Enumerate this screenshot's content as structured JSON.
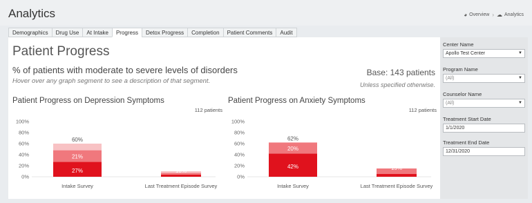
{
  "header": {
    "title": "Analytics",
    "breadcrumbs": [
      {
        "icon": "speedometer-icon",
        "label": "Overview"
      },
      {
        "icon": "cloud-icon",
        "label": "Analytics"
      }
    ]
  },
  "tabs": [
    {
      "label": "Demographics",
      "active": false
    },
    {
      "label": "Drug Use",
      "active": false
    },
    {
      "label": "At Intake",
      "active": false
    },
    {
      "label": "Progress",
      "active": true
    },
    {
      "label": "Detox Progress",
      "active": false
    },
    {
      "label": "Completion",
      "active": false
    },
    {
      "label": "Patient Comments",
      "active": false
    },
    {
      "label": "Audit",
      "active": false
    }
  ],
  "main": {
    "title": "Patient Progress",
    "subtitle": "% of patients with moderate to severe levels of disorders",
    "hint": "Hover over any graph segment to see a description of that segment.",
    "base": "Base: 143 patients",
    "base_note": "Unless specified otherwise."
  },
  "chart_data": [
    {
      "type": "bar",
      "title": "Patient Progress on Depression Symptoms",
      "count_label": "112 patients",
      "categories": [
        "Intake Survey",
        "Last Treatment Episode Survey"
      ],
      "yticks": [
        "100%",
        "80%",
        "60%",
        "40%",
        "20%",
        "0%"
      ],
      "ylim": [
        0,
        100
      ],
      "totals": [
        60,
        10
      ],
      "series": [
        {
          "values": [
            27,
            4
          ],
          "color": "#e0121d"
        },
        {
          "values": [
            21,
            3
          ],
          "color": "#f0787d"
        },
        {
          "values": [
            12,
            3
          ],
          "color": "#f8c2c4"
        }
      ],
      "labels": [
        {
          "cat": 0,
          "text": "60%",
          "y": 60
        },
        {
          "cat": 0,
          "text": "21%",
          "y": 37
        },
        {
          "cat": 0,
          "text": "27%",
          "y": 11
        },
        {
          "cat": 1,
          "text": "10%",
          "y": 11
        }
      ]
    },
    {
      "type": "bar",
      "title": "Patient Progress on Anxiety Symptoms",
      "count_label": "112 patients",
      "categories": [
        "Intake Survey",
        "Last Treatment Episode Survey"
      ],
      "yticks": [
        "100%",
        "80%",
        "60%",
        "40%",
        "20%",
        "0%"
      ],
      "ylim": [
        0,
        100
      ],
      "totals": [
        62,
        15
      ],
      "series": [
        {
          "values": [
            42,
            5
          ],
          "color": "#e0121d"
        },
        {
          "values": [
            20,
            10
          ],
          "color": "#f0787d"
        }
      ],
      "labels": [
        {
          "cat": 0,
          "text": "62%",
          "y": 62
        },
        {
          "cat": 0,
          "text": "20%",
          "y": 51
        },
        {
          "cat": 0,
          "text": "42%",
          "y": 19
        },
        {
          "cat": 1,
          "text": "15%",
          "y": 16
        }
      ]
    }
  ],
  "filters": {
    "center": {
      "label": "Center Name",
      "value": "Apollo Test Center"
    },
    "program": {
      "label": "Program Name",
      "value": "(All)"
    },
    "counselor": {
      "label": "Counselor Name",
      "value": "(All)"
    },
    "start_date": {
      "label": "Treatment Start Date",
      "value": "1/1/2020"
    },
    "end_date": {
      "label": "Treatment End Date",
      "value": "12/31/2020"
    }
  }
}
